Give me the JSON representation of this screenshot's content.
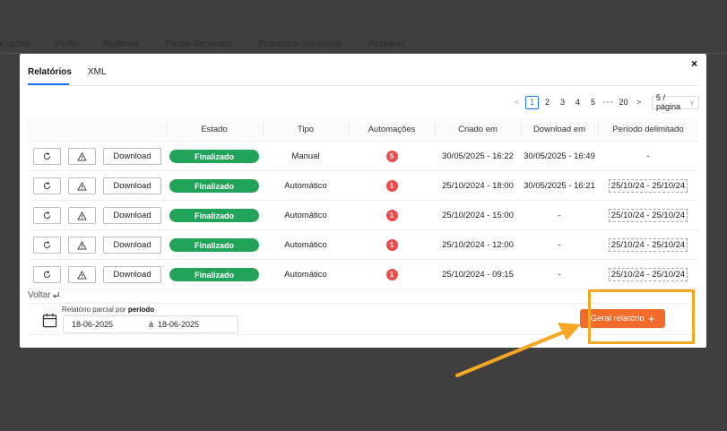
{
  "background_tabs": [
    "ucuções",
    "Perfis",
    "Auditoria",
    "Partes Sensíveis",
    "Processos Sensíveis",
    "Relatório"
  ],
  "modal": {
    "close_label": "×",
    "tabs": [
      "Relatórios",
      "XML"
    ],
    "active_tab": "Relatórios"
  },
  "pagination": {
    "prev": "<",
    "next": ">",
    "pages": [
      "1",
      "2",
      "3",
      "4",
      "5"
    ],
    "dots": "•••",
    "last": "20",
    "current": "1",
    "page_size": "5 / página"
  },
  "table": {
    "headers": [
      "",
      "Estado",
      "Tipo",
      "Automações",
      "Criado em",
      "Download em",
      "Período delimitado"
    ],
    "download_label": "Download",
    "rows": [
      {
        "estado": "Finalizado",
        "tipo": "Manual",
        "automacoes": "5",
        "criado": "30/05/2025 - 16:22",
        "download": "30/05/2025 - 16:49",
        "periodo": "-",
        "periodo_dashed": false
      },
      {
        "estado": "Finalizado",
        "tipo": "Automático",
        "automacoes": "1",
        "criado": "25/10/2024 - 18:00",
        "download": "30/05/2025 - 16:21",
        "periodo": "25/10/24 - 25/10/24",
        "periodo_dashed": true
      },
      {
        "estado": "Finalizado",
        "tipo": "Automático",
        "automacoes": "1",
        "criado": "25/10/2024 - 15:00",
        "download": "-",
        "periodo": "25/10/24 - 25/10/24",
        "periodo_dashed": true
      },
      {
        "estado": "Finalizado",
        "tipo": "Automático",
        "automacoes": "1",
        "criado": "25/10/2024 - 12:00",
        "download": "-",
        "periodo": "25/10/24 - 25/10/24",
        "periodo_dashed": true
      },
      {
        "estado": "Finalizado",
        "tipo": "Automático",
        "automacoes": "1",
        "criado": "25/10/2024 - 09:15",
        "download": "-",
        "periodo": "25/10/24 - 25/10/24",
        "periodo_dashed": true
      }
    ]
  },
  "footer": {
    "voltar": "Voltar",
    "period_label_prefix": "Relatório parcial por ",
    "period_label_bold": "período",
    "date_from": "18-06-2025",
    "date_sep": "à",
    "date_to": "18-06-2025",
    "generate_label": "Geral relatório",
    "generate_icon": "+"
  },
  "colors": {
    "status_green": "#21a35a",
    "badge_red": "#ef4b4b",
    "primary_orange": "#f36b2a",
    "highlight_yellow": "#f5a623",
    "accent_blue": "#1677ff"
  }
}
